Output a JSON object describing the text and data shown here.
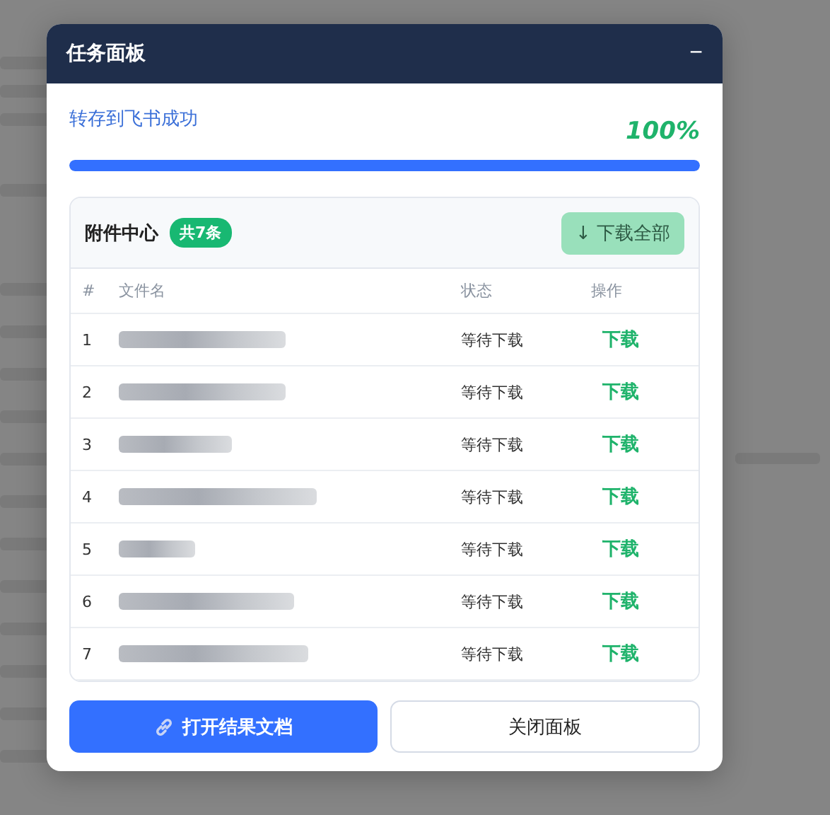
{
  "window": {
    "title": "任务面板",
    "minimize_icon": "−"
  },
  "progress": {
    "label": "转存到飞书成功",
    "percent": "100%",
    "level": 1
  },
  "attachments": {
    "title": "附件中心",
    "count_badge": "共7条",
    "download_all": {
      "label": "下载全部",
      "icon": "↓",
      "disabled": true
    },
    "columns": [
      "#",
      "文件名",
      "状态",
      "操作"
    ],
    "rows": [
      {
        "index": "1",
        "status": "等待下载",
        "action": "下载"
      },
      {
        "index": "2",
        "status": "等待下载",
        "action": "下载"
      },
      {
        "index": "3",
        "status": "等待下载",
        "action": "下载"
      },
      {
        "index": "4",
        "status": "等待下载",
        "action": "下载"
      },
      {
        "index": "5",
        "status": "等待下载",
        "action": "下载"
      },
      {
        "index": "6",
        "status": "等待下载",
        "action": "下载"
      },
      {
        "index": "7",
        "status": "等待下载",
        "action": "下载"
      }
    ]
  },
  "buttons": [
    {
      "kind": "primary",
      "label": "打开结果文档"
    },
    {
      "kind": "secondary",
      "label": "关闭面板"
    }
  ]
}
